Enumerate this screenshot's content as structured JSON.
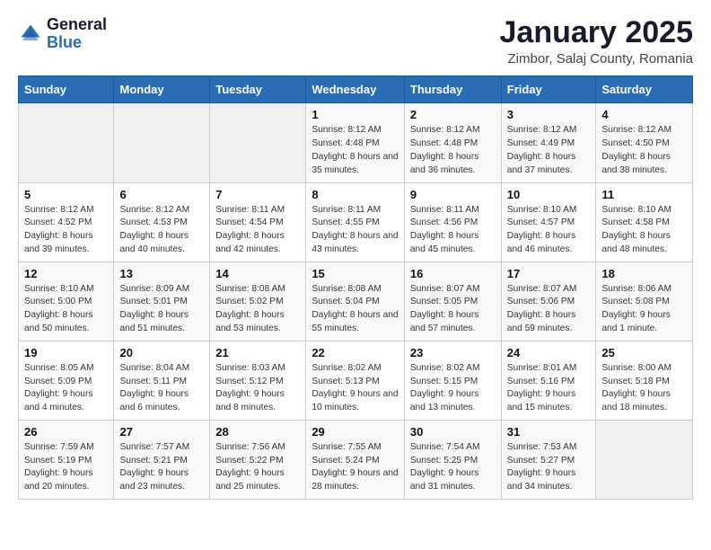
{
  "header": {
    "logo_general": "General",
    "logo_blue": "Blue",
    "month_title": "January 2025",
    "location": "Zimbor, Salaj County, Romania"
  },
  "days_of_week": [
    "Sunday",
    "Monday",
    "Tuesday",
    "Wednesday",
    "Thursday",
    "Friday",
    "Saturday"
  ],
  "weeks": [
    [
      {
        "day": "",
        "sunrise": "",
        "sunset": "",
        "daylight": ""
      },
      {
        "day": "",
        "sunrise": "",
        "sunset": "",
        "daylight": ""
      },
      {
        "day": "",
        "sunrise": "",
        "sunset": "",
        "daylight": ""
      },
      {
        "day": "1",
        "sunrise": "Sunrise: 8:12 AM",
        "sunset": "Sunset: 4:48 PM",
        "daylight": "Daylight: 8 hours and 35 minutes."
      },
      {
        "day": "2",
        "sunrise": "Sunrise: 8:12 AM",
        "sunset": "Sunset: 4:48 PM",
        "daylight": "Daylight: 8 hours and 36 minutes."
      },
      {
        "day": "3",
        "sunrise": "Sunrise: 8:12 AM",
        "sunset": "Sunset: 4:49 PM",
        "daylight": "Daylight: 8 hours and 37 minutes."
      },
      {
        "day": "4",
        "sunrise": "Sunrise: 8:12 AM",
        "sunset": "Sunset: 4:50 PM",
        "daylight": "Daylight: 8 hours and 38 minutes."
      }
    ],
    [
      {
        "day": "5",
        "sunrise": "Sunrise: 8:12 AM",
        "sunset": "Sunset: 4:52 PM",
        "daylight": "Daylight: 8 hours and 39 minutes."
      },
      {
        "day": "6",
        "sunrise": "Sunrise: 8:12 AM",
        "sunset": "Sunset: 4:53 PM",
        "daylight": "Daylight: 8 hours and 40 minutes."
      },
      {
        "day": "7",
        "sunrise": "Sunrise: 8:11 AM",
        "sunset": "Sunset: 4:54 PM",
        "daylight": "Daylight: 8 hours and 42 minutes."
      },
      {
        "day": "8",
        "sunrise": "Sunrise: 8:11 AM",
        "sunset": "Sunset: 4:55 PM",
        "daylight": "Daylight: 8 hours and 43 minutes."
      },
      {
        "day": "9",
        "sunrise": "Sunrise: 8:11 AM",
        "sunset": "Sunset: 4:56 PM",
        "daylight": "Daylight: 8 hours and 45 minutes."
      },
      {
        "day": "10",
        "sunrise": "Sunrise: 8:10 AM",
        "sunset": "Sunset: 4:57 PM",
        "daylight": "Daylight: 8 hours and 46 minutes."
      },
      {
        "day": "11",
        "sunrise": "Sunrise: 8:10 AM",
        "sunset": "Sunset: 4:58 PM",
        "daylight": "Daylight: 8 hours and 48 minutes."
      }
    ],
    [
      {
        "day": "12",
        "sunrise": "Sunrise: 8:10 AM",
        "sunset": "Sunset: 5:00 PM",
        "daylight": "Daylight: 8 hours and 50 minutes."
      },
      {
        "day": "13",
        "sunrise": "Sunrise: 8:09 AM",
        "sunset": "Sunset: 5:01 PM",
        "daylight": "Daylight: 8 hours and 51 minutes."
      },
      {
        "day": "14",
        "sunrise": "Sunrise: 8:08 AM",
        "sunset": "Sunset: 5:02 PM",
        "daylight": "Daylight: 8 hours and 53 minutes."
      },
      {
        "day": "15",
        "sunrise": "Sunrise: 8:08 AM",
        "sunset": "Sunset: 5:04 PM",
        "daylight": "Daylight: 8 hours and 55 minutes."
      },
      {
        "day": "16",
        "sunrise": "Sunrise: 8:07 AM",
        "sunset": "Sunset: 5:05 PM",
        "daylight": "Daylight: 8 hours and 57 minutes."
      },
      {
        "day": "17",
        "sunrise": "Sunrise: 8:07 AM",
        "sunset": "Sunset: 5:06 PM",
        "daylight": "Daylight: 8 hours and 59 minutes."
      },
      {
        "day": "18",
        "sunrise": "Sunrise: 8:06 AM",
        "sunset": "Sunset: 5:08 PM",
        "daylight": "Daylight: 9 hours and 1 minute."
      }
    ],
    [
      {
        "day": "19",
        "sunrise": "Sunrise: 8:05 AM",
        "sunset": "Sunset: 5:09 PM",
        "daylight": "Daylight: 9 hours and 4 minutes."
      },
      {
        "day": "20",
        "sunrise": "Sunrise: 8:04 AM",
        "sunset": "Sunset: 5:11 PM",
        "daylight": "Daylight: 9 hours and 6 minutes."
      },
      {
        "day": "21",
        "sunrise": "Sunrise: 8:03 AM",
        "sunset": "Sunset: 5:12 PM",
        "daylight": "Daylight: 9 hours and 8 minutes."
      },
      {
        "day": "22",
        "sunrise": "Sunrise: 8:02 AM",
        "sunset": "Sunset: 5:13 PM",
        "daylight": "Daylight: 9 hours and 10 minutes."
      },
      {
        "day": "23",
        "sunrise": "Sunrise: 8:02 AM",
        "sunset": "Sunset: 5:15 PM",
        "daylight": "Daylight: 9 hours and 13 minutes."
      },
      {
        "day": "24",
        "sunrise": "Sunrise: 8:01 AM",
        "sunset": "Sunset: 5:16 PM",
        "daylight": "Daylight: 9 hours and 15 minutes."
      },
      {
        "day": "25",
        "sunrise": "Sunrise: 8:00 AM",
        "sunset": "Sunset: 5:18 PM",
        "daylight": "Daylight: 9 hours and 18 minutes."
      }
    ],
    [
      {
        "day": "26",
        "sunrise": "Sunrise: 7:59 AM",
        "sunset": "Sunset: 5:19 PM",
        "daylight": "Daylight: 9 hours and 20 minutes."
      },
      {
        "day": "27",
        "sunrise": "Sunrise: 7:57 AM",
        "sunset": "Sunset: 5:21 PM",
        "daylight": "Daylight: 9 hours and 23 minutes."
      },
      {
        "day": "28",
        "sunrise": "Sunrise: 7:56 AM",
        "sunset": "Sunset: 5:22 PM",
        "daylight": "Daylight: 9 hours and 25 minutes."
      },
      {
        "day": "29",
        "sunrise": "Sunrise: 7:55 AM",
        "sunset": "Sunset: 5:24 PM",
        "daylight": "Daylight: 9 hours and 28 minutes."
      },
      {
        "day": "30",
        "sunrise": "Sunrise: 7:54 AM",
        "sunset": "Sunset: 5:25 PM",
        "daylight": "Daylight: 9 hours and 31 minutes."
      },
      {
        "day": "31",
        "sunrise": "Sunrise: 7:53 AM",
        "sunset": "Sunset: 5:27 PM",
        "daylight": "Daylight: 9 hours and 34 minutes."
      },
      {
        "day": "",
        "sunrise": "",
        "sunset": "",
        "daylight": ""
      }
    ]
  ]
}
